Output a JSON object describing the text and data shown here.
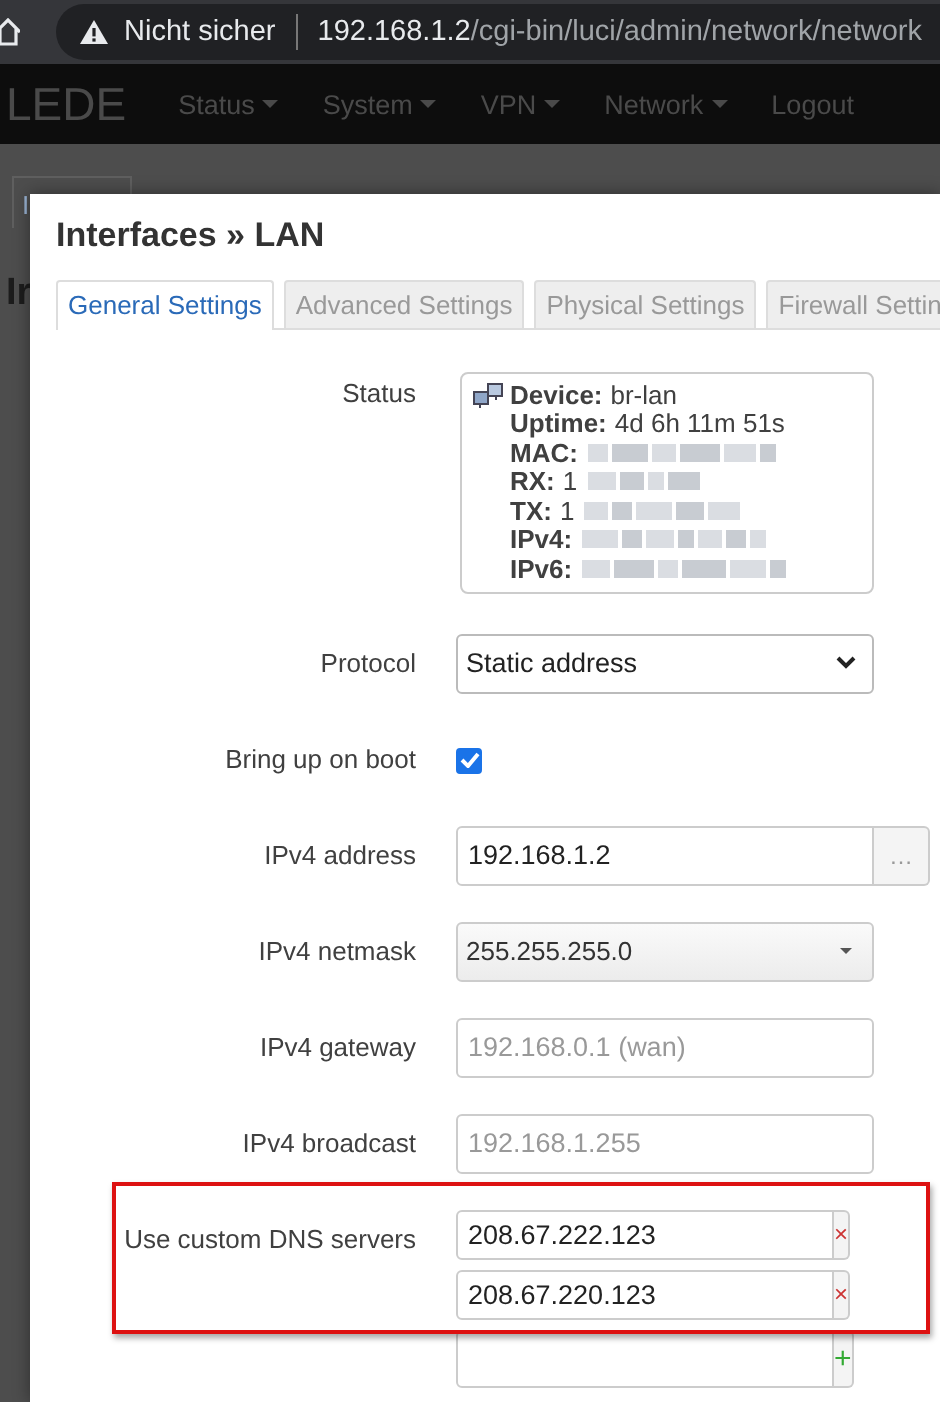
{
  "browser": {
    "security_label": "Nicht sicher",
    "url_host": "192.168.1.2",
    "url_path": "/cgi-bin/luci/admin/network/network"
  },
  "nav": {
    "brand": "LEDE",
    "menus": [
      {
        "label": "Status",
        "dropdown": true
      },
      {
        "label": "System",
        "dropdown": true
      },
      {
        "label": "VPN",
        "dropdown": true
      },
      {
        "label": "Network",
        "dropdown": true
      },
      {
        "label": "Logout",
        "dropdown": false
      }
    ]
  },
  "background": {
    "tab_fragment": "I",
    "heading_fragment": "Ir"
  },
  "modal": {
    "title": "Interfaces » LAN",
    "tabs": [
      {
        "label": "General Settings",
        "selected": true
      },
      {
        "label": "Advanced Settings",
        "selected": false
      },
      {
        "label": "Physical Settings",
        "selected": false
      },
      {
        "label": "Firewall Settin",
        "selected": false
      }
    ],
    "status": {
      "label": "Status",
      "lines": [
        {
          "key": "Device:",
          "value": "br-lan",
          "redacted": false
        },
        {
          "key": "Uptime:",
          "value": "4d 6h 11m 51s",
          "redacted": false
        },
        {
          "key": "MAC:",
          "redacted": true
        },
        {
          "key": "RX:",
          "value": "1",
          "redacted": true
        },
        {
          "key": "TX:",
          "value": "1",
          "redacted": true
        },
        {
          "key": "IPv4:",
          "redacted": true
        },
        {
          "key": "IPv6:",
          "redacted": true
        }
      ]
    },
    "fields": [
      {
        "kind": "select",
        "label": "Protocol",
        "value": "Static address"
      },
      {
        "kind": "checkbox",
        "label": "Bring up on boot",
        "checked": true
      },
      {
        "kind": "text",
        "label": "IPv4 address",
        "value": "192.168.1.2",
        "button": "…"
      },
      {
        "kind": "combo",
        "label": "IPv4 netmask",
        "value": "255.255.255.0"
      },
      {
        "kind": "text",
        "label": "IPv4 gateway",
        "placeholder": "192.168.0.1 (wan)"
      },
      {
        "kind": "text",
        "label": "IPv4 broadcast",
        "placeholder": "192.168.1.255"
      },
      {
        "kind": "list",
        "label": "Use custom DNS servers",
        "highlighted": true,
        "items": [
          {
            "value": "208.67.222.123",
            "kind": "remove",
            "button": "×"
          },
          {
            "value": "208.67.220.123",
            "kind": "remove",
            "button": "×"
          },
          {
            "kind": "add",
            "button": "+"
          }
        ]
      }
    ]
  }
}
